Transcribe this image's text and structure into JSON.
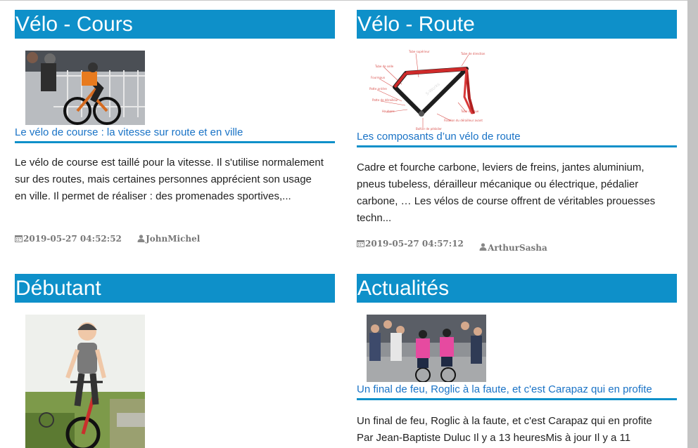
{
  "sections": [
    {
      "title": "Vélo - Cours",
      "article_link": "Le vélo de course : la vitesse sur route et en ville",
      "excerpt": "Le vélo de course est taillé pour la vitesse. Il s'utilise normalement sur des routes, mais certaines personnes apprécient son usage en ville. Il permet de réaliser : des promenades sportives,...",
      "date": "2019-05-27 04:52:52",
      "author": "JohnMichel"
    },
    {
      "title": "Vélo - Route",
      "article_link": "Les composants d’un vélo de route",
      "excerpt": "Cadre et fourche carbone, leviers de freins, jantes aluminium, pneus tubeless, dérailleur mécanique ou électrique, pédalier carbone, … Les vélos de course offrent de véritables prouesses techn...",
      "date": "2019-05-27 04:57:12",
      "author": "ArthurSasha"
    },
    {
      "title": "Débutant"
    },
    {
      "title": "Actualités",
      "article_link": "Un final de feu, Roglic à la faute, et c'est Carapaz qui en profite",
      "excerpt": "Un final de feu, Roglic à la faute, et c'est Carapaz qui en profite Par Jean-Baptiste Duluc Il y a 13 heuresMis à jour Il y a 11"
    }
  ],
  "icons": {
    "date": "calendar-icon",
    "author": "user-icon"
  },
  "colors": {
    "header_bg": "#0e90c9",
    "link": "#1a73c6"
  }
}
